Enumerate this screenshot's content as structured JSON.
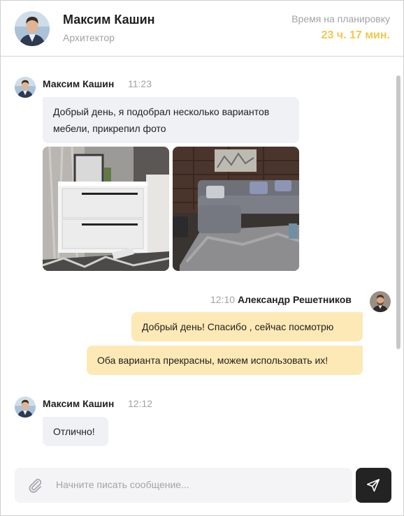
{
  "header": {
    "name": "Максим Кашин",
    "role": "Архитектор",
    "plan_label": "Время на планировку",
    "plan_value": "23 ч. 17 мин."
  },
  "messages": [
    {
      "sender": "Максим Кашин",
      "time": "11:23",
      "direction": "in",
      "bubbles": [
        {
          "line1": "Добрый день, я подобрал несколько вариантов",
          "line2": "мебели, прикрепил фото"
        }
      ],
      "attachments": [
        "nightstand-photo",
        "sofa-photo"
      ]
    },
    {
      "sender": "Александр Решетников",
      "time": "12:10",
      "direction": "out",
      "bubbles": [
        {
          "text": "Добрый день! Спасибо , сейчас посмотрю"
        },
        {
          "text": "Оба варианта прекрасны, можем использовать их!"
        }
      ]
    },
    {
      "sender": "Максим Кашин",
      "time": "12:12",
      "direction": "in",
      "bubbles": [
        {
          "text": "Отлично!"
        }
      ]
    }
  ],
  "composer": {
    "placeholder": "Начните писать сообщение..."
  },
  "icons": {
    "attach": "paperclip-icon",
    "send": "send-icon"
  },
  "colors": {
    "accent_time": "#f2c84b",
    "incoming_bubble": "#f0f1f5",
    "outgoing_bubble": "#fde9b5",
    "send_button": "#232323",
    "muted_text": "#a3a3a3"
  }
}
